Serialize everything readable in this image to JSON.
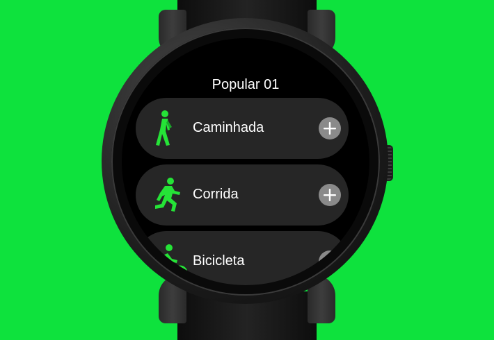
{
  "background_color": "#0ee23d",
  "accent_color": "#25e337",
  "screen": {
    "title": "Popular 01",
    "activities": [
      {
        "label": "Caminhada",
        "icon": "walking-icon",
        "has_add": true
      },
      {
        "label": "Corrida",
        "icon": "running-icon",
        "has_add": true
      },
      {
        "label": "Bicicleta",
        "icon": "cycling-icon",
        "has_add": true
      }
    ]
  }
}
